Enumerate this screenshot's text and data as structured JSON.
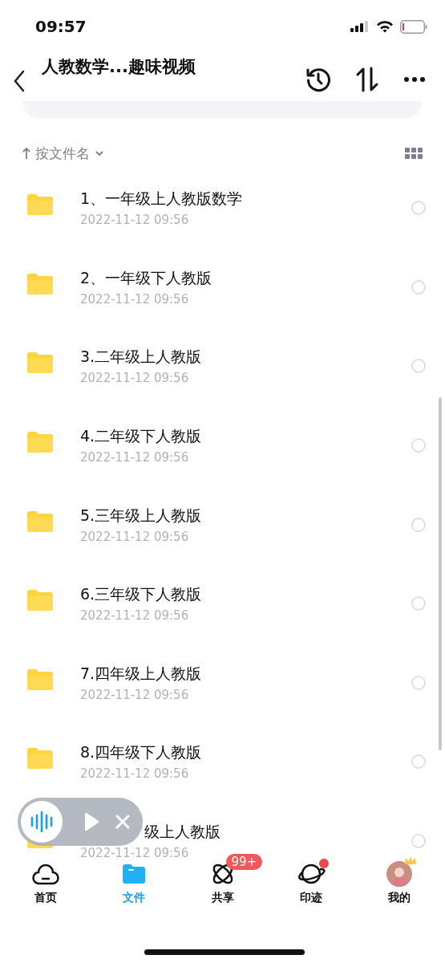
{
  "status_bar": {
    "time": "09:57"
  },
  "header": {
    "title": "人教数学...趣味视频"
  },
  "sort": {
    "label": "按文件名"
  },
  "files": [
    {
      "name": "1、一年级上人教版数学",
      "date": "2022-11-12 09:56",
      "selected": false
    },
    {
      "name": "2、一年级下人教版",
      "date": "2022-11-12 09:56",
      "selected": false
    },
    {
      "name": "3.二年级上人教版",
      "date": "2022-11-12 09:56",
      "selected": false
    },
    {
      "name": "4.二年级下人教版",
      "date": "2022-11-12 09:56",
      "selected": false
    },
    {
      "name": "5.三年级上人教版",
      "date": "2022-11-12 09:56",
      "selected": false
    },
    {
      "name": "6.三年级下人教版",
      "date": "2022-11-12 09:56",
      "selected": false
    },
    {
      "name": "7.四年级上人教版",
      "date": "2022-11-12 09:56",
      "selected": false
    },
    {
      "name": "8.四年级下人教版",
      "date": "2022-11-12 09:56",
      "selected": false
    },
    {
      "name": "级上人教版",
      "date": "2022-11-12 09:56",
      "selected": false,
      "covered": true
    }
  ],
  "tabs": [
    {
      "kind": "home",
      "label": "首页",
      "selected": false
    },
    {
      "kind": "files",
      "label": "文件",
      "selected": true
    },
    {
      "kind": "share",
      "label": "共享",
      "selected": false,
      "badge": "99+"
    },
    {
      "kind": "planet",
      "label": "印迹",
      "selected": false,
      "dot": true
    },
    {
      "kind": "avatar",
      "label": "我的",
      "selected": false
    }
  ]
}
